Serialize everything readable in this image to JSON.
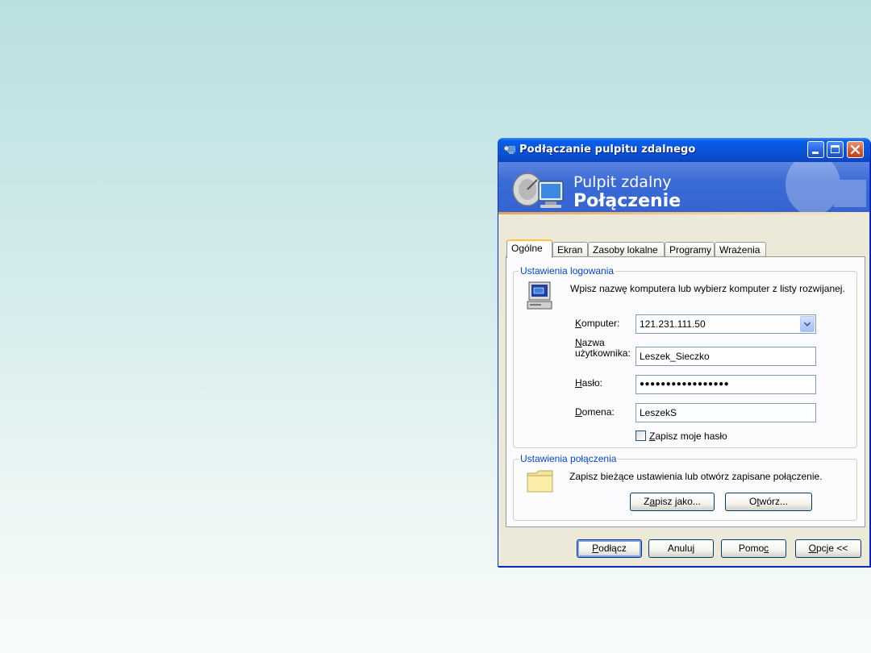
{
  "window": {
    "title": "Podłączanie pulpitu zdalnego",
    "banner_line1": "Pulpit zdalny",
    "banner_line2": "Połączenie"
  },
  "tabs": [
    {
      "label": "Ogólne",
      "active": true
    },
    {
      "label": "Ekran",
      "active": false
    },
    {
      "label": "Zasoby lokalne",
      "active": false
    },
    {
      "label": "Programy",
      "active": false
    },
    {
      "label": "Wrażenia",
      "active": false
    }
  ],
  "login_group": {
    "legend": "Ustawienia logowania",
    "instruction": "Wpisz nazwę komputera lub wybierz komputer z listy rozwijanej.",
    "computer_label": "Komputer:",
    "computer_value": "121.231.111.50",
    "username_label_1": "Nazwa",
    "username_label_2": "użytkownika:",
    "username_value": "Leszek_Sieczko",
    "password_label": "Hasło:",
    "password_value": "●●●●●●●●●●●●●●●●●",
    "domain_label": "Domena:",
    "domain_value": "LeszekS",
    "save_password_label": "Zapisz moje hasło",
    "save_password_checked": false
  },
  "connection_group": {
    "legend": "Ustawienia połączenia",
    "instruction": "Zapisz bieżące ustawienia lub otwórz zapisane połączenie.",
    "save_as_label": "Zapisz jako...",
    "open_label": "Otwórz..."
  },
  "footer": {
    "connect_label": "Podłącz",
    "cancel_label": "Anuluj",
    "help_label": "Pomoc",
    "options_label": "Opcje <<"
  },
  "colors": {
    "titlebar": "#0855dd",
    "window_bg": "#ece9d8",
    "group_legend": "#0046d5",
    "tab_highlight": "#ffc83c"
  }
}
